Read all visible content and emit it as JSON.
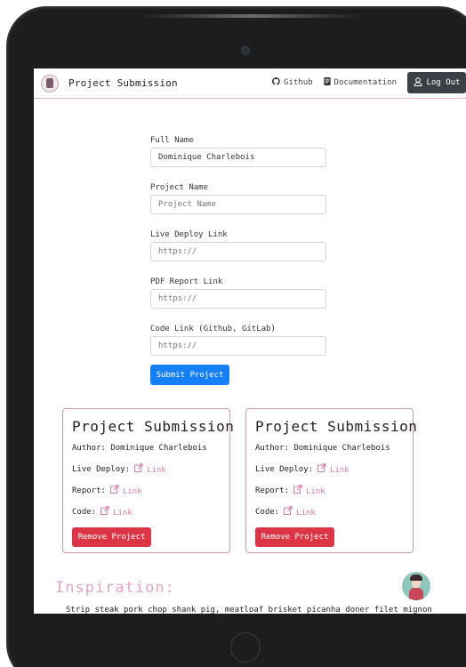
{
  "navbar": {
    "brand": "Project Submission",
    "github_label": "Github",
    "docs_label": "Documentation",
    "logout_label": "Log Out"
  },
  "form": {
    "full_name_label": "Full Name",
    "full_name_value": "Dominique Charlebois",
    "project_name_label": "Project Name",
    "project_name_placeholder": "Project Name",
    "live_deploy_label": "Live Deploy Link",
    "live_deploy_placeholder": "https://",
    "pdf_report_label": "PDF Report Link",
    "pdf_report_placeholder": "https://",
    "code_link_label": "Code Link (Github, GitLab)",
    "code_link_placeholder": "https://",
    "submit_label": "Submit Project"
  },
  "cards": [
    {
      "title": "Project Submission",
      "author": "Author: Dominique Charlebois",
      "live_deploy_label": "Live Deploy:",
      "report_label": "Report:",
      "code_label": "Code:",
      "link_text": "Link",
      "remove_label": "Remove Project"
    },
    {
      "title": "Project Submission",
      "author": "Author: Dominique Charlebois",
      "live_deploy_label": "Live Deploy:",
      "report_label": "Report:",
      "code_label": "Code:",
      "link_text": "Link",
      "remove_label": "Remove Project"
    }
  ],
  "inspiration": {
    "heading": "Inspiration:",
    "text": "Strip steak pork chop shank pig, meatloaf brisket picanha doner filet mignon"
  },
  "icons": {
    "github": "github-icon",
    "docs": "document-icon",
    "logout": "user-icon",
    "link": "external-link-icon"
  },
  "colors": {
    "accent": "#d07fa8",
    "primary_button": "#1580f5",
    "danger_button": "#dc3545",
    "dark_button": "#3b4046",
    "card_border": "#c99aab"
  }
}
